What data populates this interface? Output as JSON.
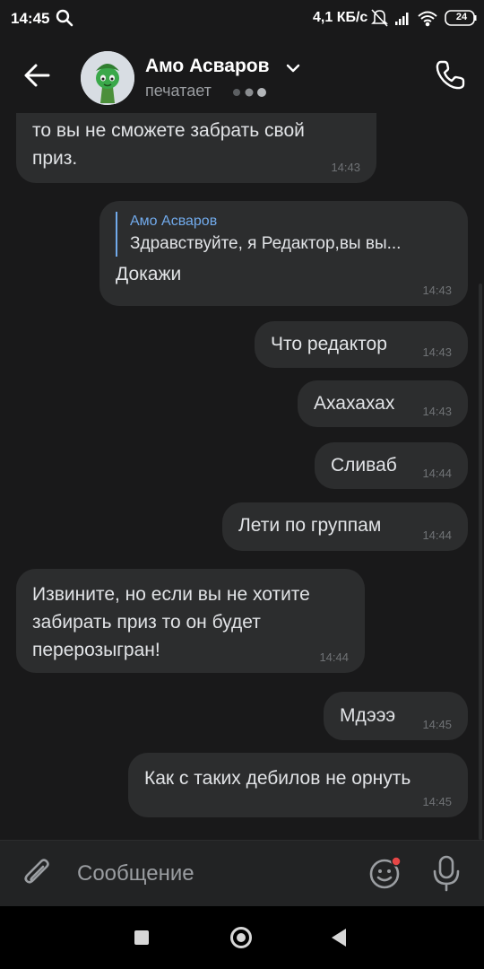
{
  "status_bar": {
    "time": "14:45",
    "net_speed": "4,1 КБ/с",
    "battery": "24",
    "icons": [
      "search-icon",
      "mute-icon",
      "signal-icon",
      "wifi-icon",
      "battery-icon"
    ]
  },
  "header": {
    "contact_name": "Амо Асваров",
    "status": "печатает",
    "icons": [
      "back-arrow-icon",
      "chevron-down-icon",
      "typing-dots-icon",
      "phone-icon"
    ]
  },
  "messages": [
    {
      "side": "in",
      "lines": [
        "то вы не сможете забрать свой",
        "приз."
      ],
      "time": "14:43"
    },
    {
      "side": "out",
      "reply_author": "Амо Асваров",
      "reply_text": "Здравствуйте, я Редактор,вы вы...",
      "lines": [
        "Докажи"
      ],
      "time": "14:43"
    },
    {
      "side": "out",
      "lines": [
        "Что редактор"
      ],
      "time": "14:43"
    },
    {
      "side": "out",
      "lines": [
        "Ахахахах"
      ],
      "time": "14:43"
    },
    {
      "side": "out",
      "lines": [
        "Сливаб"
      ],
      "time": "14:44"
    },
    {
      "side": "out",
      "lines": [
        "Лети по группам"
      ],
      "time": "14:44"
    },
    {
      "side": "in",
      "lines": [
        "Извините, но если вы не хотите",
        "забирать приз то он будет",
        "перерозыгран!"
      ],
      "time": "14:44"
    },
    {
      "side": "out",
      "lines": [
        "Мдэээ"
      ],
      "time": "14:45"
    },
    {
      "side": "out",
      "lines": [
        "Как с таких дебилов не орнуть"
      ],
      "time": "14:45"
    }
  ],
  "composer": {
    "placeholder": "Сообщение",
    "icons": [
      "paperclip-icon",
      "emoji-icon",
      "microphone-icon"
    ]
  },
  "colors": {
    "background": "#19191a",
    "bubble": "#2c2d2e",
    "accent": "#71aaeb",
    "emoji_badge": "#e64646"
  }
}
